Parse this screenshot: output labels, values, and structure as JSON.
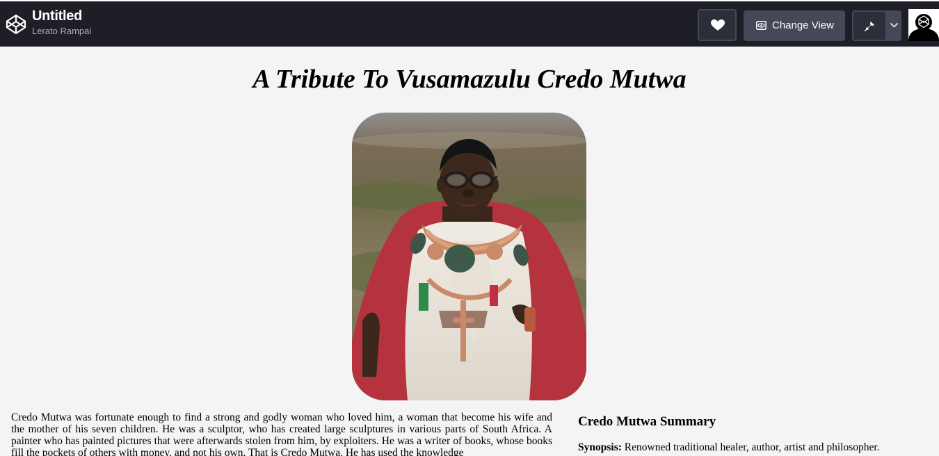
{
  "header": {
    "title": "Untitled",
    "author": "Lerato Rampai",
    "change_view_label": "Change View"
  },
  "icons": {
    "logo": "codepen-logo-icon",
    "heart": "heart-icon",
    "change_view": "eye-icon",
    "pin": "pin-icon",
    "dropdown": "chevron-down-icon",
    "avatar": "user-avatar"
  },
  "colors": {
    "topbar_bg": "#1e1f26",
    "button_bg": "#444857",
    "page_bg": "#f4f4f4"
  },
  "page": {
    "title": "A Tribute To Vusamazulu Credo Mutwa",
    "bio": "Credo Mutwa was fortunate enough to find a strong and godly woman who loved him, a woman that become his wife and the mother of his seven children. He was a sculptor, who has created large sculptures in various parts of South Africa. A painter who has painted pictures that were afterwards stolen from him, by exploiters. He was a writer of books, whose books fill the pockets of others with money, and not his own. That is Credo Mutwa. He has used the knowledge",
    "summary_title": "Credo Mutwa Summary",
    "synopsis_label": "Synopsis:",
    "synopsis_text": " Renowned traditional healer, author, artist and philosopher."
  }
}
